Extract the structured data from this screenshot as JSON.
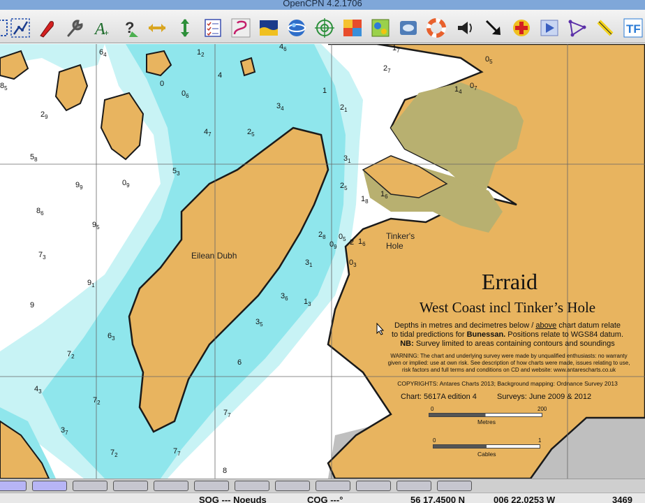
{
  "app": {
    "title": "OpenCPN 4.2.1706"
  },
  "toolbar": {
    "buttons": [
      {
        "name": "zoom-in-button",
        "icon": "dashed-square-icon"
      },
      {
        "name": "route-button",
        "icon": "route-icon"
      },
      {
        "name": "mob-button",
        "icon": "red-marker-icon"
      },
      {
        "name": "settings-button",
        "icon": "wrench-icon"
      },
      {
        "name": "text-button",
        "icon": "text-a-icon"
      },
      {
        "name": "query-button",
        "icon": "query-icon"
      },
      {
        "name": "measure-button",
        "icon": "measure-icon"
      },
      {
        "name": "track-button",
        "icon": "track-icon"
      },
      {
        "name": "route-manager-button",
        "icon": "checklist-icon"
      },
      {
        "name": "tracks-button",
        "icon": "curve-icon"
      },
      {
        "name": "tides-button",
        "icon": "tide-icon"
      },
      {
        "name": "google-earth-button",
        "icon": "globe-icon"
      },
      {
        "name": "radar-button",
        "icon": "target-icon"
      },
      {
        "name": "grib-button",
        "icon": "weather-map-icon"
      },
      {
        "name": "dashboard-button",
        "icon": "dashboard-icon"
      },
      {
        "name": "logbook-button",
        "icon": "logbook-icon"
      },
      {
        "name": "lifering-button",
        "icon": "lifering-icon"
      },
      {
        "name": "sound-button",
        "icon": "horn-icon"
      },
      {
        "name": "arrow-down-right-button",
        "icon": "arrow-down-right-icon"
      },
      {
        "name": "firstaid-button",
        "icon": "firstaid-icon"
      },
      {
        "name": "play-button",
        "icon": "play-icon"
      },
      {
        "name": "polygon-button",
        "icon": "polygon-icon"
      },
      {
        "name": "highlighter-button",
        "icon": "highlighter-icon"
      },
      {
        "name": "tf-button",
        "icon": "tf-icon"
      }
    ]
  },
  "map": {
    "place_names": {
      "eilean_dubh": "Eilean Dubh",
      "tinkers": "Tinker's",
      "hole": "Hole"
    },
    "legend": {
      "title": "Erraid",
      "subtitle": "West Coast incl Tinker’s Hole",
      "line1_pre": "Depths in metres and decimetres below / ",
      "line1_underline": "above",
      "line1_post": " chart datum relate",
      "line2_pre": "to tidal predictions for ",
      "line2_bold": "Bunessan.",
      "line2_post": "  Positions relate to WGS84 datum.",
      "line3_bold": "NB:",
      "line3_post": " Survey limited to areas containing contours and soundings",
      "warning1": "WARNING: The chart and underlying survey were made by unqualified enthusiasts: no warranty",
      "warning2": "given or implied: use at own risk. See description of how charts were made, issues relating to use,",
      "warning3": "risk factors and full terms and conditions on CD and website: www.antarescharts.co.uk",
      "copyright": "COPYRIGHTS: Antares Charts 2013; Background mapping: Ordnance Survey 2013",
      "chart": "Chart: 5617A edition 4",
      "surveys": "Surveys: June 2009 & 2012",
      "scale1_start": "0",
      "scale1_end": "200",
      "scale1_unit": "Metres",
      "scale2_start": "0",
      "scale2_end": "1",
      "scale2_unit": "Cables"
    },
    "soundings": [
      {
        "main": "6",
        "sub": "4"
      },
      {
        "main": "1",
        "sub": "2"
      },
      {
        "main": "4",
        "sub": "6"
      },
      {
        "main": "1",
        "sub": "7"
      },
      {
        "main": "0",
        "sub": "5"
      },
      {
        "main": "8",
        "sub": "5"
      },
      {
        "main": "0",
        "sub": ""
      },
      {
        "main": "0",
        "sub": "6"
      },
      {
        "main": "4",
        "sub": ""
      },
      {
        "main": "1",
        "sub": ""
      },
      {
        "main": "2",
        "sub": "7"
      },
      {
        "main": "1",
        "sub": "4"
      },
      {
        "main": "0",
        "sub": "7"
      },
      {
        "main": "3",
        "sub": "4"
      },
      {
        "main": "2",
        "sub": "1"
      },
      {
        "main": "2",
        "sub": "9"
      },
      {
        "main": "4",
        "sub": "7"
      },
      {
        "main": "2",
        "sub": "5"
      },
      {
        "main": "5",
        "sub": "8"
      },
      {
        "main": "3",
        "sub": "1"
      },
      {
        "main": "5",
        "sub": "3"
      },
      {
        "main": "9",
        "sub": "9"
      },
      {
        "main": "0",
        "sub": "9"
      },
      {
        "main": "2",
        "sub": "5"
      },
      {
        "main": "1",
        "sub": "8"
      },
      {
        "main": "1",
        "sub": "6"
      },
      {
        "main": "8",
        "sub": "6"
      },
      {
        "main": "9",
        "sub": "5"
      },
      {
        "main": "2",
        "sub": "8"
      },
      {
        "main": "0",
        "sub": "5"
      },
      {
        "main": "0",
        "sub": "9"
      },
      {
        "main": "2",
        "sub": ""
      },
      {
        "main": "1",
        "sub": "6"
      },
      {
        "main": "7",
        "sub": "3"
      },
      {
        "main": "3",
        "sub": "1"
      },
      {
        "main": "0",
        "sub": "3"
      },
      {
        "main": "9",
        "sub": "1"
      },
      {
        "main": "3",
        "sub": "6"
      },
      {
        "main": "1",
        "sub": "3"
      },
      {
        "main": "9",
        "sub": ""
      },
      {
        "main": "3",
        "sub": "5"
      },
      {
        "main": "6",
        "sub": "3"
      },
      {
        "main": "7",
        "sub": "2"
      },
      {
        "main": "6",
        "sub": ""
      },
      {
        "main": "4",
        "sub": "3"
      },
      {
        "main": "7",
        "sub": "2"
      },
      {
        "main": "7",
        "sub": "7"
      },
      {
        "main": "3",
        "sub": "7"
      },
      {
        "main": "7",
        "sub": "2"
      },
      {
        "main": "7",
        "sub": "7"
      },
      {
        "main": "8",
        "sub": ""
      }
    ]
  },
  "tabbar": {
    "tab_count": 12,
    "active_tabs": [
      0,
      1
    ]
  },
  "status": {
    "sog": "SOG --- Noeuds",
    "cog": "COG ---°",
    "lat": "56 17.4500 N",
    "lon": "006 22.0253 W",
    "scale": "3469"
  },
  "colors": {
    "land": "#e8b45f",
    "land_green": "#b8b070",
    "shallow": "#8fe6ec",
    "mid": "#c8f3f5",
    "deep": "#ffffff",
    "grey_land": "#bfbfbf"
  }
}
